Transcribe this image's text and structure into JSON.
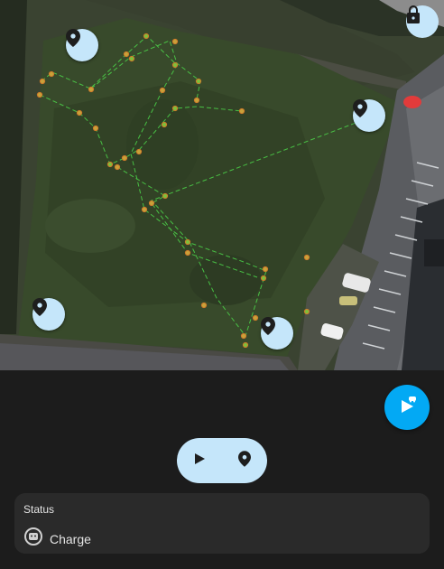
{
  "map": {
    "pins": [
      "location-pin",
      "location-pin",
      "location-pin",
      "location-pin"
    ],
    "lock_icon": "lock-icon"
  },
  "controls": {
    "start_icon": "play-vacuum-icon",
    "play_icon": "play-icon",
    "pin_icon": "map-pin-icon",
    "accent": "#03a9f4",
    "pill_color": "#c5e6fa"
  },
  "status": {
    "title": "Status",
    "value": "Charge",
    "icon": "robot-mower-icon"
  }
}
